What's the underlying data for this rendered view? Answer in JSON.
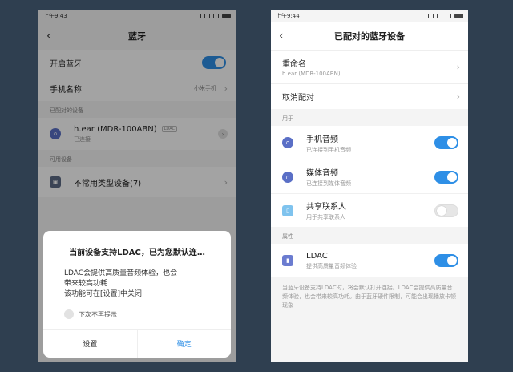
{
  "left": {
    "status_time": "上午9:43",
    "title": "蓝牙",
    "bluetooth_on_label": "开启蓝牙",
    "phone_name_label": "手机名称",
    "phone_name_value": "小米手机",
    "paired_section": "已配对的设备",
    "paired_device": {
      "name": "h.ear (MDR-100ABN)",
      "tag": "LDAC",
      "status": "已连接"
    },
    "available_section": "可用设备",
    "uncommon_devices": "不常用类型设备(7)",
    "dialog": {
      "title": "当前设备支持LDAC，已为您默认连…",
      "body_line1": "LDAC会提供高质量音频体验，也会",
      "body_line2": "带来较高功耗",
      "body_line3": "该功能可在[设置]中关闭",
      "checkbox_label": "下次不再提示",
      "settings_btn": "设置",
      "confirm_btn": "确定"
    }
  },
  "right": {
    "status_time": "上午9:44",
    "title": "已配对的蓝牙设备",
    "rename_label": "重命名",
    "rename_value": "h.ear (MDR-100ABN)",
    "unpair_label": "取消配对",
    "use_section": "用于",
    "phone_audio": {
      "label": "手机音频",
      "sub": "已连接到手机音频"
    },
    "media_audio": {
      "label": "媒体音频",
      "sub": "已连接到媒体音频"
    },
    "contacts": {
      "label": "共享联系人",
      "sub": "用于共享联系人"
    },
    "attr_section": "属性",
    "ldac": {
      "label": "LDAC",
      "sub": "提供高质量音频体验"
    },
    "footer": "当蓝牙设备支持LDAC时，将会默认打开连接。LDAC会提供高质量音频体验，也会带来较高功耗。由于蓝牙硬件限制，可能会出现播放卡顿现象"
  }
}
